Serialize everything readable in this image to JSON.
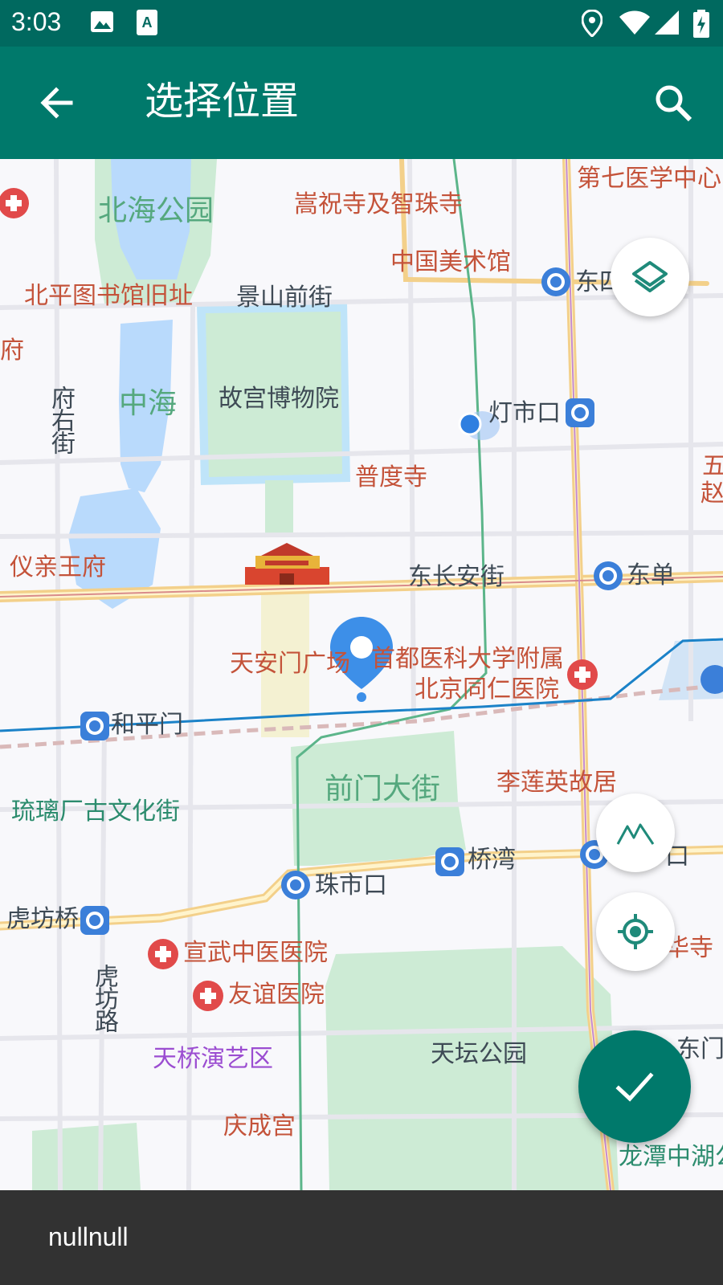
{
  "status_bar": {
    "time": "3:03",
    "icons": [
      "image-icon",
      "a-app-icon",
      "location-icon",
      "wifi-icon",
      "cell-signal-icon",
      "battery-icon"
    ]
  },
  "app_bar": {
    "title": "选择位置",
    "back_icon": "arrow-back-icon",
    "search_icon": "search-icon"
  },
  "map": {
    "labels": {
      "beihai": "北海公园",
      "songzhu": "嵩祝寺及智珠寺",
      "diqi": "第七医学中心",
      "meishuguan": "中国美术馆",
      "dongsi": "东四",
      "beiping": "北平图书馆旧址",
      "jingshan": "景山前街",
      "fu": "府",
      "fuyoujie": "府右街",
      "zhonghai": "中海",
      "gugong": "故宫博物院",
      "dengshikou": "灯市口",
      "wu": "五",
      "zhao": "赵",
      "pudusi": "普度寺",
      "yiqin": "仪亲王府",
      "dongchangan": "东长安街",
      "dongdan": "东单",
      "tiananmen": "天安门广场",
      "shoudu": "首都医科大学附属",
      "tongren": "北京同仁医院",
      "hepingmen": "和平门",
      "qianmen": "前门大街",
      "lilianying": "李莲英故居",
      "liulichang": "琉璃厂古文化街",
      "qiaowan": "桥湾",
      "kou": "口",
      "zhushikou": "珠市口",
      "hufangqiao": "虎坊桥",
      "huasi": "华寺",
      "xuanwu": "宣武中医医院",
      "hufanglu": "虎坊路",
      "youyi": "友谊医院",
      "tianqiao": "天桥演艺区",
      "tiantan": "天坛公园",
      "dongmen": "东门",
      "qingcheng": "庆成宫",
      "longtan": "龙潭中湖公"
    }
  },
  "controls": {
    "layers_icon": "layers-icon",
    "terrain_icon": "terrain-icon",
    "my_location_icon": "my-location-icon",
    "confirm_icon": "check-icon"
  },
  "colors": {
    "primary": "#00796b",
    "primary_dark": "#00695f",
    "marker": "#3d8fe8"
  },
  "snackbar": {
    "message": "nullnull"
  }
}
